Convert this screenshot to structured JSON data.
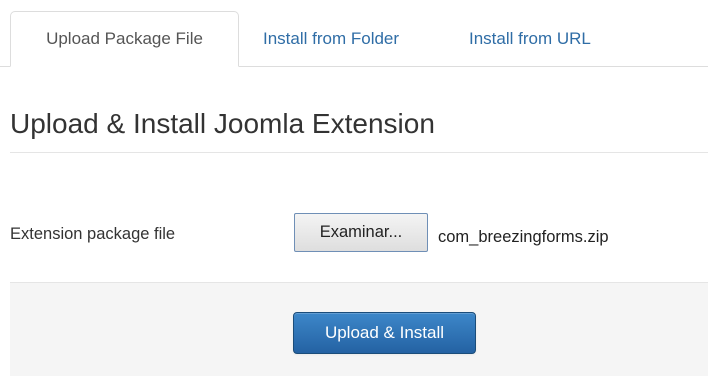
{
  "tabs": [
    {
      "label": "Upload Package File",
      "active": true
    },
    {
      "label": "Install from Folder",
      "active": false
    },
    {
      "label": "Install from URL",
      "active": false
    }
  ],
  "page_title": "Upload & Install Joomla Extension",
  "form": {
    "field_label": "Extension package file",
    "browse_label": "Examinar...",
    "selected_file": "com_breezingforms.zip",
    "submit_label": "Upload & Install"
  },
  "colors": {
    "link": "#2f6da6",
    "primary_button": "#2a6cae",
    "actions_background": "#f5f5f5"
  }
}
